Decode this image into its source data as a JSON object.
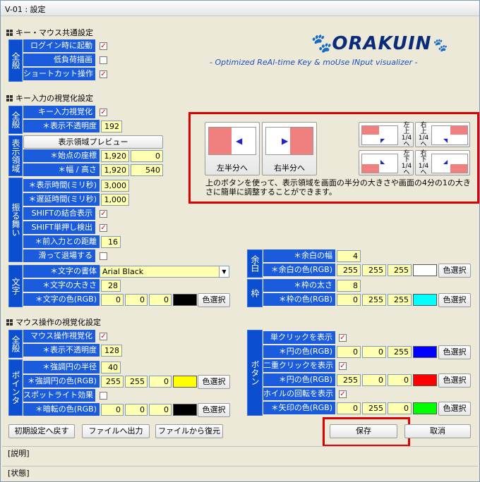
{
  "window": {
    "title": "V-01 : 設定"
  },
  "logo": {
    "name": "ORAKUIN",
    "tagline": "- Optimized ReAl-time Key & moUse INput visualizer -"
  },
  "sec1": {
    "title": "キー・マウス共通設定",
    "tab": "全般",
    "rows": [
      {
        "label": "ログイン時に起動",
        "checked": true
      },
      {
        "label": "低負荷描画",
        "checked": false
      },
      {
        "label": "ショートカット操作",
        "checked": true
      }
    ]
  },
  "sec2": {
    "title": "キー入力の視覚化設定",
    "general": {
      "tab": "全般",
      "enable_label": "キー入力視覚化",
      "enable_checked": true,
      "opacity_label": "＊表示不透明度",
      "opacity": "192"
    },
    "region": {
      "tab": "表示領域",
      "preview_button": "表示領域プレビュー",
      "start_label": "＊始点の座標",
      "start_x": "1,920",
      "start_y": "0",
      "size_label": "＊幅 / 高さ",
      "width": "1,920",
      "height": "540"
    },
    "behavior": {
      "tab": "振る舞い",
      "display_time_label": "＊表示時間(ミリ秒)",
      "display_time": "3,000",
      "delay_time_label": "＊遅延時間(ミリ秒)",
      "delay_time": "1,000",
      "shift_combine_label": "SHIFTの結合表示",
      "shift_combine": true,
      "shift_single_label": "SHIFT単押し検出",
      "shift_single": true,
      "prev_dist_label": "＊前入力との距離",
      "prev_dist": "16",
      "slide_label": "滑って退場する",
      "slide": false
    },
    "text": {
      "tab": "文字",
      "font_label": "＊文字の書体",
      "font": "Arial Black",
      "size_label": "＊文字の大きさ",
      "size": "28",
      "color_label": "＊文字の色(RGB)",
      "r": "0",
      "g": "0",
      "b": "0",
      "color": "#000000",
      "pick": "色選択"
    },
    "margin": {
      "tab": "余白",
      "width_label": "＊余白の幅",
      "width": "4",
      "color_label": "＊余白の色(RGB)",
      "r": "255",
      "g": "255",
      "b": "255",
      "color": "#ffffff",
      "pick": "色選択"
    },
    "frame": {
      "tab": "枠",
      "thick_label": "＊枠の太さ",
      "thick": "8",
      "color_label": "＊枠の色(RGB)",
      "r": "0",
      "g": "255",
      "b": "255",
      "color": "#00ffff",
      "pick": "色選択"
    }
  },
  "helper": {
    "left_half": "左半分へ",
    "right_half": "右半分へ",
    "tl": [
      "左",
      "上",
      "1/4",
      "へ"
    ],
    "tr": [
      "右",
      "上",
      "1/4",
      "へ"
    ],
    "bl": [
      "左",
      "下",
      "1/4",
      "へ"
    ],
    "br": [
      "右",
      "下",
      "1/4",
      "へ"
    ],
    "desc": "上のボタンを使って、表示領域を画面の半分の大きさや画面の4分の1の大きさに簡単に調整することができます。"
  },
  "sec3": {
    "title": "マウス操作の視覚化設定",
    "general": {
      "tab": "全般",
      "enable_label": "マウス操作視覚化",
      "enable_checked": true,
      "opacity_label": "＊表示不透明度",
      "opacity": "128"
    },
    "pointer": {
      "tab": "ポインタ",
      "radius_label": "＊強調円の半径",
      "radius": "40",
      "color_label": "＊強調円の色(RGB)",
      "r": "255",
      "g": "255",
      "b": "0",
      "color": "#ffff00",
      "pick": "色選択",
      "spot_label": "スポットライト効果",
      "spot": false,
      "dark_label": "＊暗転の色(RGB)",
      "dr": "0",
      "dg": "0",
      "db": "0",
      "dcolor": "#000000",
      "dpick": "色選択"
    },
    "buttons": {
      "tab": "ボタン",
      "single_label": "単クリックを表示",
      "single": true,
      "single_color_label": "＊円の色(RGB)",
      "sr": "0",
      "sg": "0",
      "sb": "255",
      "scolor": "#0000ff",
      "spick": "色選択",
      "double_label": "二重クリックを表示",
      "double": true,
      "double_color_label": "＊円の色(RGB)",
      "dr": "255",
      "dg": "0",
      "db": "0",
      "dcolor": "#ff0000",
      "dpick": "色選択",
      "wheel_label": "ホイルの回転を表示",
      "wheel": true,
      "wheel_color_label": "＊矢印の色(RGB)",
      "wr": "0",
      "wg": "255",
      "wb": "0",
      "wcolor": "#00ff00",
      "wpick": "色選択"
    }
  },
  "footer": {
    "reset": "初期設定へ戻す",
    "export": "ファイルへ出力",
    "import": "ファイルから復元",
    "save": "保存",
    "cancel": "取消"
  },
  "status": {
    "description": "[説明]",
    "state": "[状態]"
  }
}
